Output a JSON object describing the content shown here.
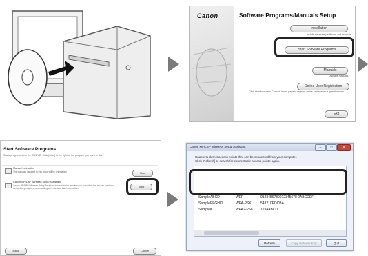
{
  "arrow_icon": "right-triangle-arrow",
  "panel2": {
    "logo": "Canon",
    "title": "Software Programs/Manuals Setup",
    "buttons": [
      {
        "label": "Installation",
        "desc": "Installs necessary software and manuals."
      },
      {
        "label": "Start Software Programs",
        "desc": "Starts programs required for configuring settings, etc."
      },
      {
        "label": "Manuals",
        "desc": "Displays manuals."
      },
      {
        "label": "Online User Registration",
        "desc": "Click here to access Canon's home page to register online and answer a questionnaire."
      },
      {
        "label": "Exit",
        "desc": ""
      }
    ]
  },
  "panel3": {
    "title": "Start Software Programs",
    "subtitle": "Starts programs from the CD/DVD. Click [Start] to the right of the program you want to start.",
    "programs": [
      {
        "name": "Manual Instruction",
        "desc": "The manuals installed to this setup will be uninstalled.",
        "button": "Start"
      },
      {
        "name": "Canon MF/LBP Wireless Setup Assistant",
        "desc": "Canon MF/LBP Wireless Setup Assistant is a tool which enables you to confirm the access point and network key required when setting up a wireless LAN connection.",
        "button": "Start"
      }
    ],
    "back": "Back",
    "cancel": "Cancel"
  },
  "panel4": {
    "window_title": "Canon MF/LBP Wireless Setup Assistant",
    "message_line1": "Unable to detect access points that can be connected from your computer.",
    "message_line2": "Click [Refresh] to search for connectable access points again.",
    "rows": [
      {
        "ssid": "SampleABCD",
        "security": "WEP",
        "key": "0123456789012345678 9ABCDEF"
      },
      {
        "ssid": "SampleEFGHIJ",
        "security": "WPA-PSK",
        "key": "543210EDCBA"
      },
      {
        "ssid": "SampleK",
        "security": "WPA2-PSK",
        "key": "1234ABCD"
      }
    ],
    "buttons": {
      "refresh": "Refresh",
      "copy": "Copy Network Key",
      "quit": "Quit"
    }
  }
}
